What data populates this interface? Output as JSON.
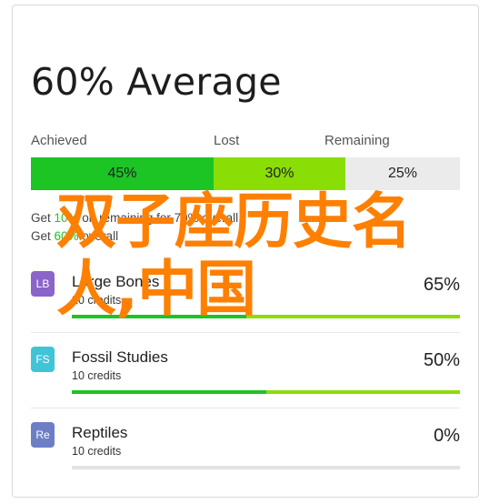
{
  "title": "60% Average",
  "headers": {
    "achieved": "Achieved",
    "lost": "Lost",
    "remaining": "Remaining"
  },
  "summary_bar": {
    "achieved_pct": 45,
    "achieved_label": "45%",
    "lost_pct": 30,
    "lost_label": "30%",
    "remaining_pct": 25,
    "remaining_label": "25%"
  },
  "notes": {
    "line1_prefix": "Get ",
    "line1_hl": "10%",
    "line1_mid": " on remaining for ",
    "line1_hl2": "70%",
    "line1_suffix": " overall",
    "line2_prefix": "Get ",
    "line2_hl": "60%",
    "line2_suffix": " overall"
  },
  "overlay_text": "双子座历史名人,中国",
  "rows": [
    {
      "badge": "LB",
      "badge_color": "#8b64c9",
      "name": "Large Bones",
      "credits": "20 credits",
      "pct_label": "65%",
      "achieved": 0.45,
      "lost": 0.55
    },
    {
      "badge": "FS",
      "badge_color": "#3fc4d8",
      "name": "Fossil Studies",
      "credits": "10 credits",
      "pct_label": "50%",
      "achieved": 0.5,
      "lost": 0.5
    },
    {
      "badge": "Re",
      "badge_color": "#6c7fc6",
      "name": "Reptiles",
      "credits": "10 credits",
      "pct_label": "0%",
      "achieved": 0,
      "lost": 0
    }
  ],
  "colors": {
    "achieved": "#1cc424",
    "lost": "#8bdd06",
    "remaining": "#ebebeb",
    "overlay": "#ff7f00"
  }
}
